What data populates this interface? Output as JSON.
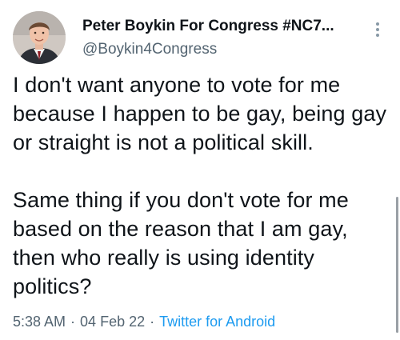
{
  "user": {
    "display_name": "Peter Boykin For Congress #NC7...",
    "handle": "@Boykin4Congress",
    "avatar_icon": "profile-photo"
  },
  "tweet": {
    "text": "I don't want anyone to vote for me because I happen to be gay, being gay or straight is not a political skill.\n\nSame thing if you don't vote for me based on the reason that I am gay, then who really is using identity politics?",
    "time": "5:38 AM",
    "separator": "·",
    "date": "04 Feb 22",
    "source": "Twitter for Android"
  },
  "icons": {
    "more": "more-options-icon"
  },
  "colors": {
    "text": "#0f1419",
    "secondary": "#536471",
    "link": "#1d9bf0"
  }
}
